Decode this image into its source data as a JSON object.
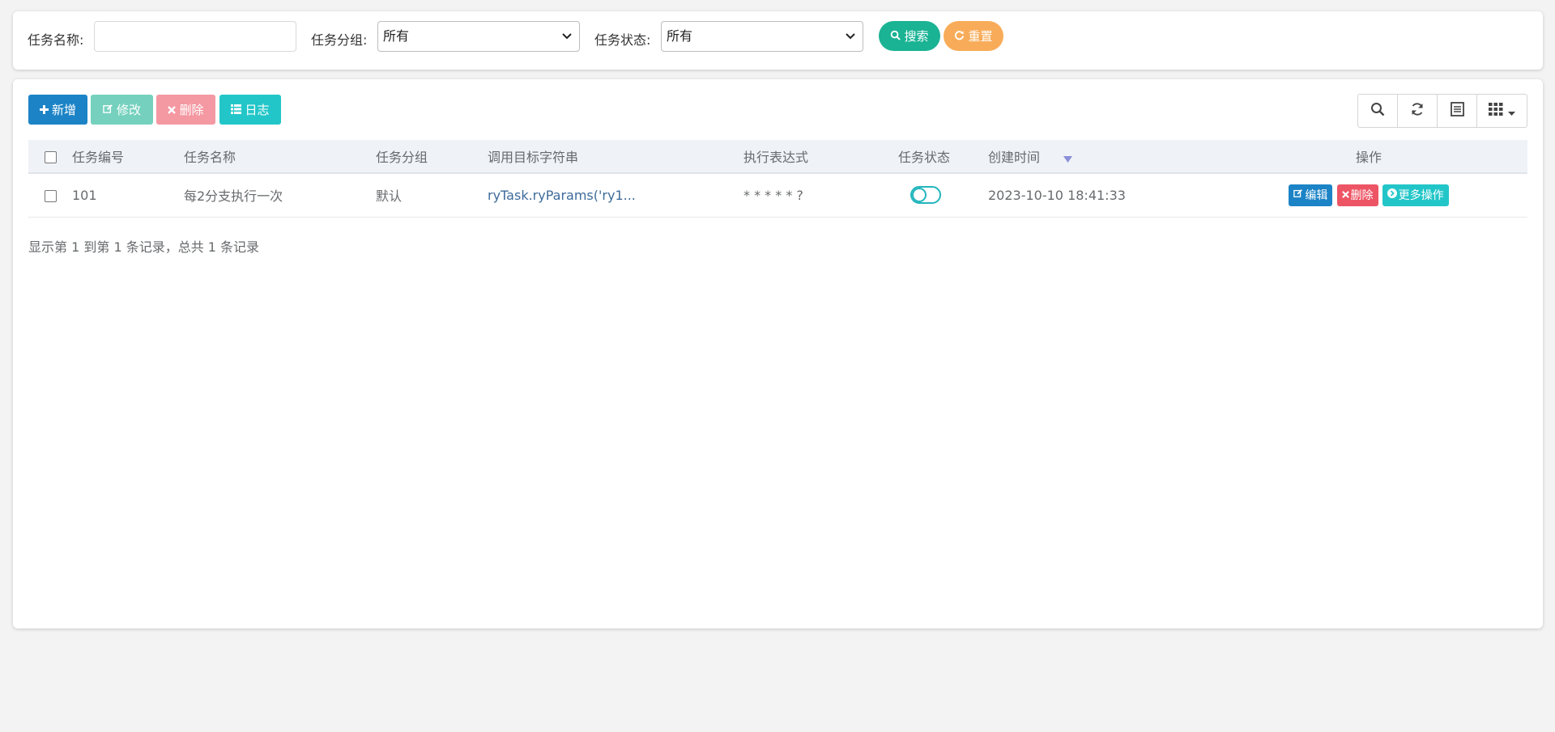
{
  "search": {
    "task_name_label": "任务名称:",
    "task_name_value": "",
    "task_group_label": "任务分组:",
    "task_group_selected": "所有",
    "task_status_label": "任务状态:",
    "task_status_selected": "所有",
    "search_button": "搜索",
    "reset_button": "重置"
  },
  "toolbar": {
    "add": "新增",
    "edit": "修改",
    "delete": "删除",
    "log": "日志"
  },
  "table": {
    "headers": {
      "id": "任务编号",
      "name": "任务名称",
      "group": "任务分组",
      "target": "调用目标字符串",
      "cron": "执行表达式",
      "status": "任务状态",
      "created": "创建时间",
      "actions": "操作"
    },
    "rows": [
      {
        "id": "101",
        "name": "每2分支执行一次",
        "group": "默认",
        "target": "ryTask.ryParams('ry1...",
        "cron": "* * * * * ?",
        "status_enabled": false,
        "created": "2023-10-10 18:41:33",
        "edit": "编辑",
        "delete": "删除",
        "more": "更多操作"
      }
    ]
  },
  "pagination": {
    "info": "显示第 1 到第 1 条记录，总共 1 条记录"
  },
  "colors": {
    "primary": "#1c84c6",
    "success": "#1ab394",
    "warning": "#f8ac59",
    "danger": "#ed5565",
    "info": "#23c6c8"
  }
}
